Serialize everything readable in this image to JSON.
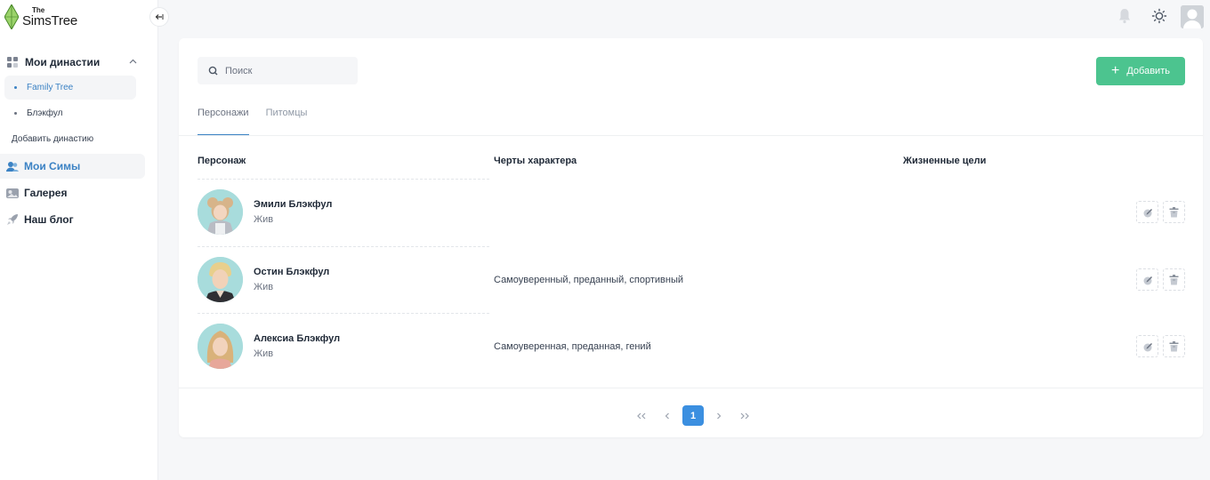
{
  "brand": {
    "line1": "The",
    "line2": "SimsTree"
  },
  "sidebar": {
    "dynasties_label": "Мои династии",
    "dynasties": [
      {
        "label": "Family Tree",
        "active": true
      },
      {
        "label": "Блэкфул",
        "active": false
      }
    ],
    "add_dynasty": "Добавить династию",
    "items": [
      {
        "label": "Мои Симы",
        "icon": "users-icon",
        "active": true
      },
      {
        "label": "Галерея",
        "icon": "gallery-icon",
        "active": false
      },
      {
        "label": "Наш блог",
        "icon": "rocket-icon",
        "active": false
      }
    ]
  },
  "search": {
    "placeholder": "Поиск"
  },
  "add_button": {
    "label": "Добавить"
  },
  "tabs": [
    {
      "label": "Персонажи",
      "active": true
    },
    {
      "label": "Питомцы",
      "active": false
    }
  ],
  "table": {
    "headers": [
      "Персонаж",
      "Черты характера",
      "Жизненные цели"
    ],
    "rows": [
      {
        "name": "Эмили Блэкфул",
        "status": "Жив",
        "traits": "",
        "goals": ""
      },
      {
        "name": "Остин Блэкфул",
        "status": "Жив",
        "traits": "Самоуверенный, преданный, спортивный",
        "goals": ""
      },
      {
        "name": "Алексиа Блэкфул",
        "status": "Жив",
        "traits": "Самоуверенная, преданная, гений",
        "goals": ""
      }
    ]
  },
  "pagination": {
    "current": "1"
  },
  "colors": {
    "accent": "#3b82c4",
    "add_button": "#4cc48f",
    "page_active": "#3b8fe0"
  }
}
